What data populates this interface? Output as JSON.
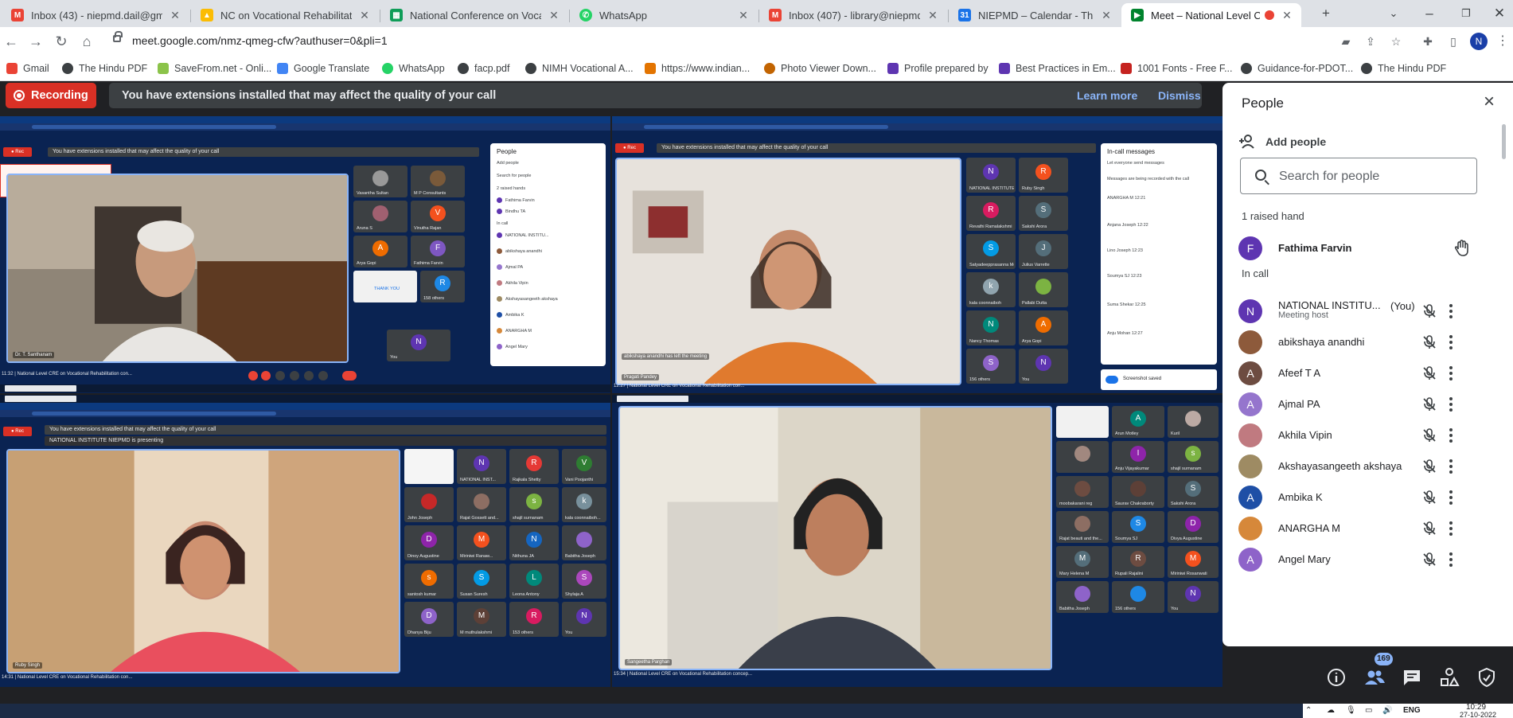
{
  "tabs": [
    {
      "label": "Inbox (43) - niepmd.dail@gmail.c",
      "icon": "gmail-icon",
      "color": "#ea4335"
    },
    {
      "label": "NC on Vocational Rehabilitation",
      "icon": "drive-icon",
      "color": "#fbbc04"
    },
    {
      "label": "National Conference on Vocational",
      "icon": "sheets-icon",
      "color": "#0f9d58"
    },
    {
      "label": "WhatsApp",
      "icon": "whatsapp-icon",
      "color": "#25d366"
    },
    {
      "label": "Inbox (407) - library@niepmd.in",
      "icon": "gmail-icon",
      "color": "#ea4335"
    },
    {
      "label": "NIEPMD – Calendar - Thursday,",
      "icon": "calendar-icon",
      "color": "#1a73e8"
    },
    {
      "label": "Meet – National Level CRE",
      "icon": "meet-icon",
      "color": "#00832d"
    }
  ],
  "address": {
    "url": "meet.google.com/nmz-qmeg-cfw?authuser=0&pli=1"
  },
  "bookmarks": [
    {
      "label": "Gmail",
      "color": "#ea4335"
    },
    {
      "label": "The Hindu PDF",
      "color": "#3c4043"
    },
    {
      "label": "SaveFrom.net - Onli...",
      "color": "#8bc34a"
    },
    {
      "label": "Google Translate",
      "color": "#4285f4"
    },
    {
      "label": "WhatsApp",
      "color": "#25d366"
    },
    {
      "label": "facp.pdf",
      "color": "#3c4043"
    },
    {
      "label": "NIMH Vocational A...",
      "color": "#3c4043"
    },
    {
      "label": "https://www.indian...",
      "color": "#e37400"
    },
    {
      "label": "Photo Viewer Down...",
      "color": "#c26401"
    },
    {
      "label": "Profile prepared by",
      "color": "#5e35b1"
    },
    {
      "label": "Best Practices in Em...",
      "color": "#5e35b1"
    },
    {
      "label": "1001 Fonts - Free F...",
      "color": "#c5221f"
    },
    {
      "label": "Guidance-for-PDOT...",
      "color": "#3c4043"
    },
    {
      "label": "The Hindu PDF",
      "color": "#3c4043"
    }
  ],
  "banner": {
    "recording_label": "Recording",
    "message": "You have extensions installed that may affect the quality of your call",
    "learn_more": "Learn more",
    "dismiss": "Dismiss"
  },
  "stage": {
    "tl": {
      "speaker_name": "Dr. T. Santhanam",
      "meeting_title": "National Level CRE on Vocational Rehabilitation con...",
      "time": "11:32",
      "tiles": [
        "Vasantha Sultan",
        "M P Consultants",
        "Aruna S",
        "Vinutha Rajan",
        "Arya Gopi",
        "Fathima Farvin",
        "THANK YOU",
        "158 others",
        "You"
      ],
      "people_title": "People",
      "people_rows": [
        "Add people",
        "Search for people",
        "2 raised hands",
        "Fathima Farvin",
        "Bindhu TA",
        "In call",
        "NATIONAL INSTITU...",
        "abikshaya anandhi",
        "Ajmal PA",
        "Akhila Vipin",
        "Akshayasangeeth akshaya",
        "Ambika K",
        "ANARGHA M",
        "Angel Mary"
      ]
    },
    "tr": {
      "speaker_name": "Pragati Pandey",
      "meeting_title": "National Level CRE on Vocational Rehabilitation con...",
      "time": "12:27",
      "notice": "abikshaya anandhi has left the meeting",
      "tiles": [
        "NATIONAL INSTITUTE ...",
        "Ruby Singh",
        "Revathi Ramalakshmi",
        "Sakshi Arora",
        "Satyadeepprasanna Moh...",
        "Julius Varrette",
        "kala coonnaiboh",
        "Pallabi Dutta",
        "Nancy Thomas",
        "Arya Gopi",
        "156 others",
        "You"
      ],
      "chat_title": "In-call messages",
      "chat_lines": [
        "Let everyone send messages",
        "Messages are being recorded with the call",
        "ANARGHA M 12:21",
        "Anjana Joseph 12:22",
        "Lino Joseph 12:23",
        "Soumya SJ 12:23",
        "Suma Shekar 12:25",
        "Anju Mohan 12:27"
      ],
      "toast": "Screenshot saved"
    },
    "bl": {
      "speaker_name": "Ruby Singh",
      "meeting_title": "National Level CRE on Vocational Rehabilitation con...",
      "time": "14:31",
      "presenting": "NATIONAL INSTITUTE NIEPMD is presenting",
      "tiles": [
        "NATIONAL INST...",
        "Rajkala Shetty",
        "Vani Poojanthi",
        "John Joseph",
        "Rajat Gossett and...",
        "shajil surnanam",
        "kala coonnaiboh...",
        "Dinoy Augustine",
        "Miriniwi Ranaw...",
        "Nithuna JA",
        "Babitha Joseph",
        "santosh kumar",
        "Susan Suresh",
        "Leona Antony",
        "Shylaja A",
        "Dhanya Biju",
        "M muthulakshmi",
        "153 others",
        "You"
      ]
    },
    "br": {
      "speaker_name": "Sangeetha Parghan",
      "meeting_title": "National Level CRE on Vocational Rehabilitation concep...",
      "time": "15:34",
      "tiles": [
        "Arun Motley",
        "Kuril",
        "Anju Vijayakumar",
        "shajil surnanam",
        "moobakarani reg",
        "Saurav Chakraborty",
        "Sakshi Arora",
        "Rajat beauti and the...",
        "Soumya SJ",
        "Divya Augustine",
        "Mary Helena M",
        "Rupali Rajalini",
        "Miriniwi Rosanwati",
        "Babitha Joseph",
        "156 others",
        "You"
      ]
    }
  },
  "people": {
    "title": "People",
    "add_people": "Add people",
    "search_placeholder": "Search for people",
    "raised_hand_section": "1 raised hand",
    "raised_hand_person": {
      "name": "Fathima Farvin",
      "initial": "F",
      "color": "#5e35b1"
    },
    "in_call_section": "In call",
    "in_call": [
      {
        "name": "NATIONAL INSTITU...",
        "you": "(You)",
        "sub": "Meeting host",
        "initial": "N",
        "color": "#5e35b1",
        "photo": false
      },
      {
        "name": "abikshaya anandhi",
        "initial": "",
        "color": "#8d5a3b",
        "photo": true
      },
      {
        "name": "Afeef T A",
        "initial": "A",
        "color": "#6d4c41",
        "photo": false
      },
      {
        "name": "Ajmal PA",
        "initial": "A",
        "color": "#9575cd",
        "photo": false
      },
      {
        "name": "Akhila Vipin",
        "initial": "",
        "color": "#c07a80",
        "photo": true
      },
      {
        "name": "Akshayasangeeth akshaya",
        "initial": "",
        "color": "#9e8b63",
        "photo": true
      },
      {
        "name": "Ambika K",
        "initial": "A",
        "color": "#1e4fa6",
        "photo": false
      },
      {
        "name": "ANARGHA M",
        "initial": "",
        "color": "#d6883a",
        "photo": true
      },
      {
        "name": "Angel Mary",
        "initial": "A",
        "color": "#8e63c9",
        "photo": false
      }
    ]
  },
  "bottom_bar": {
    "people_count": "169"
  },
  "taskbar": {
    "lang": "ENG",
    "time": "10:29",
    "date": "27-10-2022"
  },
  "colors": {
    "recording_red": "#d93025",
    "meet_dark": "#202124",
    "accent_blue": "#8ab4f8"
  }
}
